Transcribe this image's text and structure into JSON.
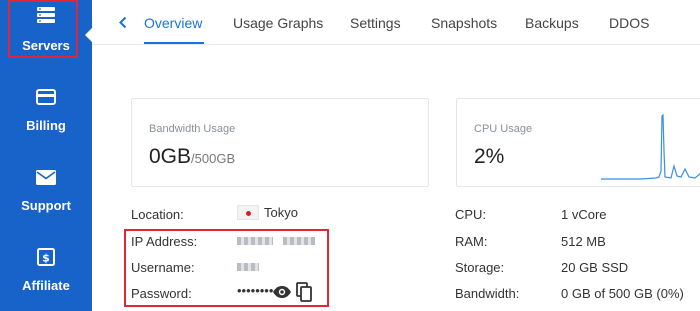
{
  "sidebar": {
    "items": [
      {
        "label": "Servers",
        "icon": "server-icon",
        "active": true
      },
      {
        "label": "Billing",
        "icon": "credit-card-icon",
        "active": false
      },
      {
        "label": "Support",
        "icon": "envelope-icon",
        "active": false
      },
      {
        "label": "Affiliate",
        "icon": "dollar-sign-icon",
        "active": false
      }
    ]
  },
  "tabs": {
    "items": [
      {
        "label": "Overview",
        "active": true
      },
      {
        "label": "Usage Graphs",
        "active": false
      },
      {
        "label": "Settings",
        "active": false
      },
      {
        "label": "Snapshots",
        "active": false
      },
      {
        "label": "Backups",
        "active": false
      },
      {
        "label": "DDOS",
        "active": false
      }
    ]
  },
  "cards": {
    "bandwidth": {
      "title": "Bandwidth Usage",
      "used": "0GB",
      "total": "/500GB"
    },
    "cpu": {
      "title": "CPU Usage",
      "value": "2%"
    }
  },
  "info_left": {
    "location": {
      "label": "Location:",
      "value": "Tokyo"
    },
    "ip": {
      "label": "IP Address:"
    },
    "username": {
      "label": "Username:"
    },
    "password": {
      "label": "Password:",
      "value": "••••••••"
    }
  },
  "info_right": {
    "cpu": {
      "label": "CPU:",
      "value": "1 vCore"
    },
    "ram": {
      "label": "RAM:",
      "value": "512 MB"
    },
    "storage": {
      "label": "Storage:",
      "value": "20 GB SSD"
    },
    "bandwidth": {
      "label": "Bandwidth:",
      "value": "0 GB of 500 GB (0%)"
    }
  },
  "colors": {
    "sidebar_bg": "#1863c9",
    "accent": "#1a73d9",
    "highlight": "#e0263b"
  }
}
